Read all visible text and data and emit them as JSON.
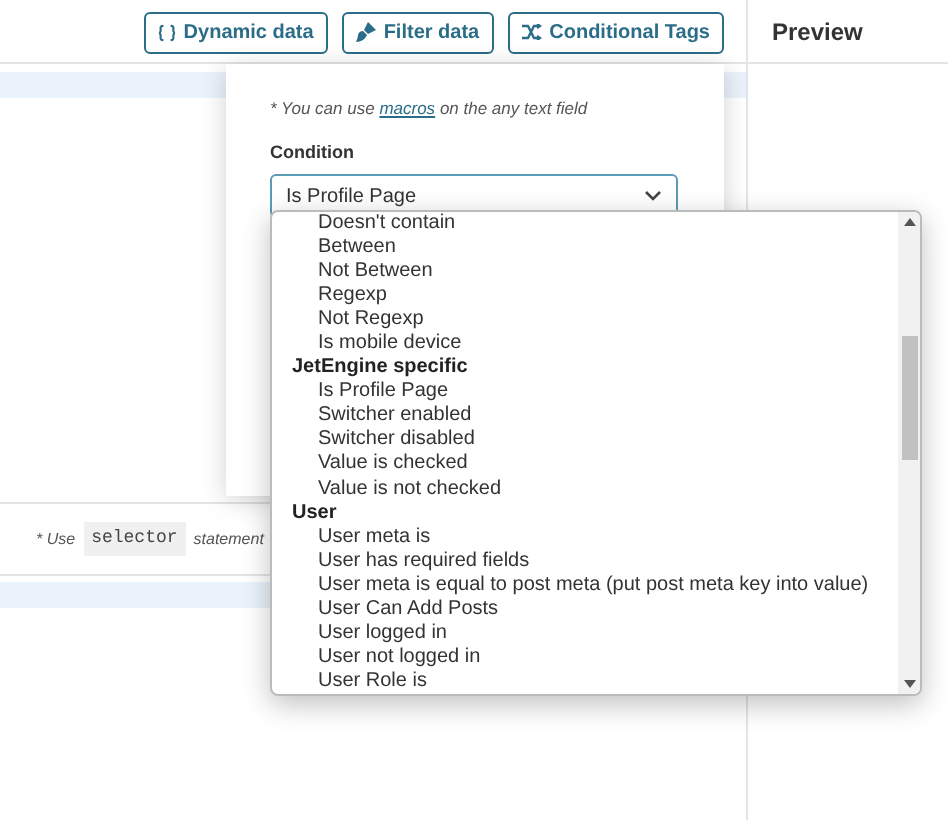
{
  "toolbar": {
    "buttons": [
      {
        "kind": "braces",
        "label": "Dynamic data"
      },
      {
        "kind": "filter",
        "label": "Filter data"
      },
      {
        "kind": "tags",
        "label": "Conditional Tags"
      }
    ]
  },
  "preview": {
    "title": "Preview"
  },
  "popup": {
    "note_before": "* You can use",
    "note_link": "macros",
    "note_after": "on the any text field",
    "condition_label": "Condition",
    "condition_value": "Is Profile Page"
  },
  "dropdown": {
    "options": [
      {
        "kind": "option",
        "label": "Doesn't contain"
      },
      {
        "kind": "option",
        "label": "Between"
      },
      {
        "kind": "option",
        "label": "Not Between"
      },
      {
        "kind": "option",
        "label": "Regexp"
      },
      {
        "kind": "option",
        "label": "Not Regexp"
      },
      {
        "kind": "option",
        "label": "Is mobile device"
      },
      {
        "kind": "group",
        "label": "JetEngine specific"
      },
      {
        "kind": "option",
        "label": "Is Profile Page"
      },
      {
        "kind": "option",
        "label": "Switcher enabled"
      },
      {
        "kind": "option",
        "label": "Switcher disabled"
      },
      {
        "kind": "option",
        "label": "Value is checked"
      },
      {
        "kind": "option",
        "label": "Value is not checked"
      },
      {
        "kind": "group",
        "label": "User"
      },
      {
        "kind": "option",
        "label": "User meta is"
      },
      {
        "kind": "option",
        "label": "User has required fields"
      },
      {
        "kind": "option",
        "label": "User meta is equal to post meta (put post meta key into value)"
      },
      {
        "kind": "option",
        "label": "User Can Add Posts"
      },
      {
        "kind": "option",
        "label": "User logged in"
      },
      {
        "kind": "option",
        "label": "User not logged in"
      },
      {
        "kind": "option",
        "label": "User Role is"
      }
    ]
  },
  "hint": {
    "prefix": "* Use",
    "code": "selector",
    "suffix": "statement"
  }
}
